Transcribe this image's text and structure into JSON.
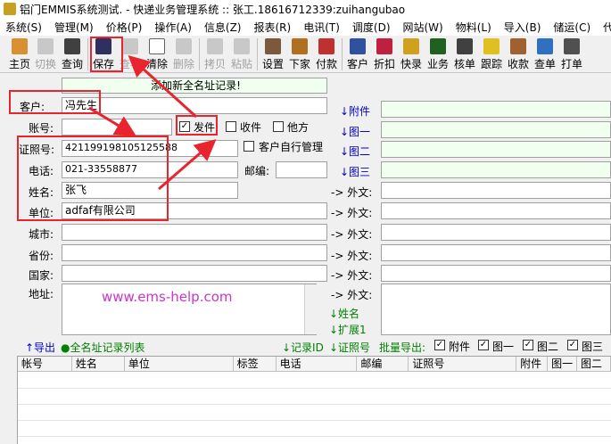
{
  "window": {
    "title": "铝门EMMIS系统测试. - 快递业务管理系统 :: 张工.18616712339:zuihangubao"
  },
  "menu": [
    "系统(S)",
    "管理(M)",
    "价格(P)",
    "操作(A)",
    "信息(Z)",
    "报表(R)",
    "电讯(T)",
    "调度(D)",
    "网站(W)",
    "物料(L)",
    "导入(B)",
    "储运(C)",
    "代派"
  ],
  "toolbar": {
    "home": "主页",
    "switch": "切换",
    "query": "查询",
    "save": "保存",
    "view": "查看",
    "clear": "清除",
    "delete": "删除",
    "copy": "拷贝",
    "paste": "粘贴",
    "settings": "设置",
    "dispatch": "下家",
    "pay": "付款",
    "customer": "客户",
    "discount": "折扣",
    "quick": "快录",
    "business": "业务",
    "check": "核单",
    "track": "跟踪",
    "collect": "收款",
    "search_order": "查单",
    "print": "打单"
  },
  "form": {
    "header": "添加新全名址记录!",
    "customer_label": "客户:",
    "customer_value": "冯先生",
    "account_label": "账号:",
    "sender_label": "发件",
    "receiver_label": "收件",
    "other_label": "他方",
    "id_label": "证照号:",
    "id_value": "421199198105125588",
    "self_manage_label": "客户自行管理",
    "phone_label": "电话:",
    "phone_value": "021-33558877",
    "postcode_label": "邮编:",
    "name_label": "姓名:",
    "name_value": "张飞",
    "company_label": "单位:",
    "company_value": "adfaf有限公司",
    "city_label": "城市:",
    "province_label": "省份:",
    "country_label": "国家:",
    "address_label": "地址:",
    "watermark": "www.ems-help.com"
  },
  "right_panel": {
    "attachment": "↓附件",
    "image1": "↓图一",
    "image2": "↓图二",
    "image3": "↓图三",
    "foreign": "-> 外文:",
    "name_link": "↓姓名",
    "extend_link": "↓扩展1"
  },
  "bottom_bar": {
    "export": "↑导出",
    "list": "●全名址记录列表",
    "record_id": "↓记录ID",
    "id_no": "↓证照号",
    "batch_export": "批量导出:",
    "opt_attach": "附件",
    "opt_img1": "图一",
    "opt_img2": "图二",
    "opt_img3": "图三"
  },
  "table": {
    "columns": [
      "帐号",
      "姓名",
      "单位",
      "标签",
      "电话",
      "邮编",
      "证照号",
      "附件",
      "图一",
      "图二"
    ]
  },
  "colors": {
    "annotation_red": "#e8252f",
    "link_blue": "#0000cc",
    "accent_green": "#008000"
  }
}
